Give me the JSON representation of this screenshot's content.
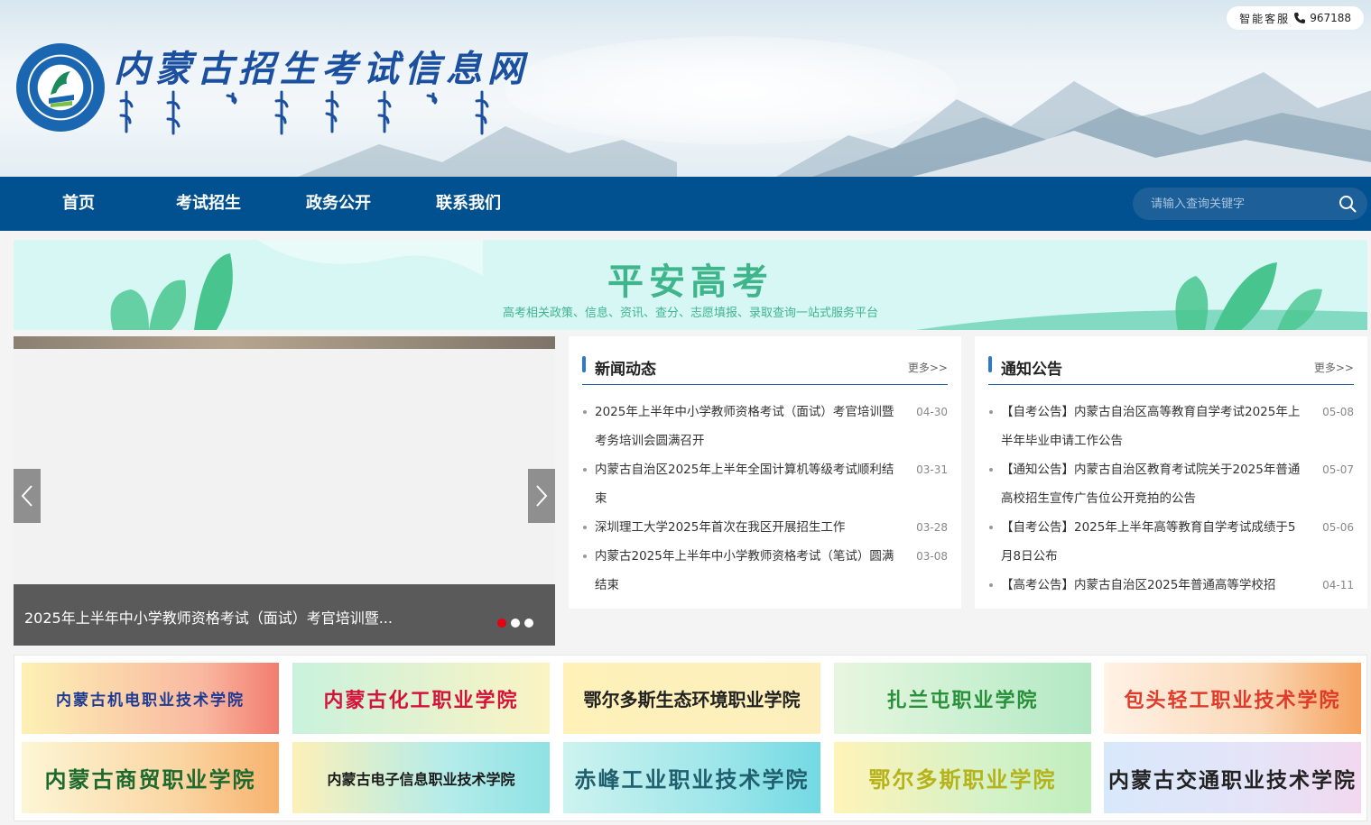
{
  "header": {
    "site_title": "内蒙古招生考试信息网",
    "service": {
      "label": "智能客服",
      "phone": "967188"
    }
  },
  "nav": {
    "items": [
      "首页",
      "考试招生",
      "政务公开",
      "联系我们"
    ],
    "search_placeholder": "请输入查询关键字"
  },
  "banner": {
    "title": "平安高考",
    "subtitle": "高考相关政策、信息、资讯、查分、志愿填报、录取查询一站式服务平台"
  },
  "slider": {
    "caption": "2025年上半年中小学教师资格考试（面试）考官培训暨...",
    "dots": 3,
    "active_dot": 0
  },
  "news": {
    "title": "新闻动态",
    "more": "更多>>",
    "items": [
      {
        "title": "2025年上半年中小学教师资格考试（面试）考官培训暨考务培训会圆满召开",
        "date": "04-30"
      },
      {
        "title": "内蒙古自治区2025年上半年全国计算机等级考试顺利结束",
        "date": "03-31"
      },
      {
        "title": "深圳理工大学2025年首次在我区开展招生工作",
        "date": "03-28"
      },
      {
        "title": "内蒙古2025年上半年中小学教师资格考试（笔试）圆满结束",
        "date": "03-08"
      }
    ]
  },
  "notices": {
    "title": "通知公告",
    "more": "更多>>",
    "items": [
      {
        "title": "【自考公告】内蒙古自治区高等教育自学考试2025年上半年毕业申请工作公告",
        "date": "05-08"
      },
      {
        "title": "【通知公告】内蒙古自治区教育考试院关于2025年普通高校招生宣传广告位公开竞拍的公告",
        "date": "05-07"
      },
      {
        "title": "【自考公告】2025年上半年高等教育自学考试成绩于5月8日公布",
        "date": "05-06"
      },
      {
        "title": "【高考公告】内蒙古自治区2025年普通高等学校招",
        "date": "04-11"
      }
    ]
  },
  "colleges": {
    "row1": [
      {
        "name": "内蒙古机电职业技术学院",
        "color": "#1f3a93"
      },
      {
        "name": "内蒙古化工职业学院",
        "color": "#d4123a"
      },
      {
        "name": "鄂尔多斯生态环境职业学院",
        "color": "#222222"
      },
      {
        "name": "扎兰屯职业学院",
        "color": "#2a8f3a"
      },
      {
        "name": "包头轻工职业技术学院",
        "color": "#e03a2b"
      }
    ],
    "row2": [
      {
        "name": "内蒙古商贸职业学院",
        "color": "#1d6a2e"
      },
      {
        "name": "内蒙古电子信息职业技术学院",
        "color": "#1a1a1a"
      },
      {
        "name": "赤峰工业职业技术学院",
        "color": "#1f5f6e"
      },
      {
        "name": "鄂尔多斯职业学院",
        "color": "#b5b21a"
      },
      {
        "name": "内蒙古交通职业技术学院",
        "color": "#222222"
      }
    ]
  }
}
